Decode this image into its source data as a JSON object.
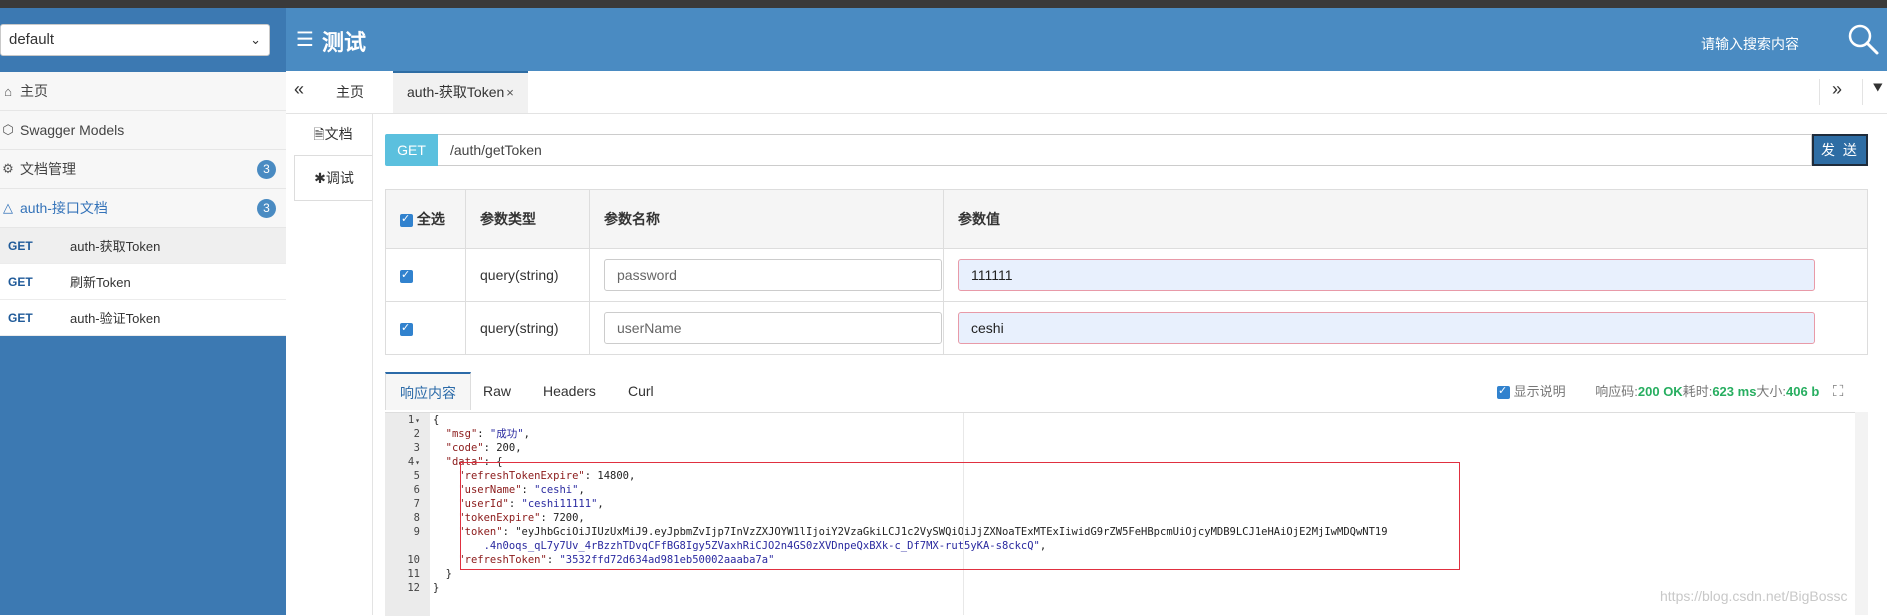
{
  "sidebar": {
    "group_select": "default",
    "menu": [
      {
        "label": "主页",
        "icon": "home-icon"
      },
      {
        "label": "Swagger Models",
        "icon": "cube-icon"
      },
      {
        "label": "文档管理",
        "icon": "gear-icon",
        "badge": "3"
      },
      {
        "label": "auth-接口文档",
        "icon": "folder-icon",
        "badge": "3"
      }
    ],
    "apis": [
      {
        "method": "GET",
        "name": "auth-获取Token"
      },
      {
        "method": "GET",
        "name": "刷新Token"
      },
      {
        "method": "GET",
        "name": "auth-验证Token"
      }
    ]
  },
  "header": {
    "title": "测试",
    "search_placeholder": "请输入搜索内容"
  },
  "tabs": {
    "home": "主页",
    "active": "auth-获取Token",
    "close": "×"
  },
  "subtabs": {
    "doc": "文档",
    "debug": "调试"
  },
  "request": {
    "method": "GET",
    "url": "/auth/getToken",
    "send": "发 送"
  },
  "params": {
    "headers": {
      "select_all": "全选",
      "type": "参数类型",
      "name": "参数名称",
      "value": "参数值"
    },
    "rows": [
      {
        "type": "query(string)",
        "name": "password",
        "value": "111111"
      },
      {
        "type": "query(string)",
        "name": "userName",
        "value": "ceshi"
      }
    ]
  },
  "response": {
    "tabs": [
      "响应内容",
      "Raw",
      "Headers",
      "Curl"
    ],
    "show_desc": "显示说明",
    "code_label": "响应码:",
    "code_value": "200 OK",
    "time_label": "耗时:",
    "time_value": "623 ms",
    "size_label": "大小:",
    "size_value": "406 b",
    "lines": [
      "{",
      "  \"msg\": \"成功\",",
      "  \"code\": 200,",
      "  \"data\": {",
      "    \"refreshTokenExpire\": 14800,",
      "    \"userName\": \"ceshi\",",
      "    \"userId\": \"ceshi11111\",",
      "    \"tokenExpire\": 7200,",
      "    \"token\": \"eyJhbGciOiJIUzUxMiJ9.eyJpbmZvIjp7InVzZXJOYW1lIjoiY2VzaGkiLCJ1c2VySWQiOiJjZXNoaTExMTExIiwidG9rZW5FeHBpcmUiOjcyMDB9LCJ1eHAiOjE2MjIwMDQwNT19",
      "        .4n0oqs_qL7y7Uv_4rBzzhTDvqCFfBG8Igy5ZVaxhRiCJO2n4GS0zXVDnpeQxBXk-c_Df7MX-rut5yKA-s8ckcQ\",",
      "    \"refreshToken\": \"3532ffd72d634ad981eb50002aaaba7a\"",
      "  }",
      "}"
    ],
    "gutter": [
      "1",
      "2",
      "3",
      "4",
      "5",
      "6",
      "7",
      "8",
      "9",
      "",
      "10",
      "11",
      "12"
    ]
  },
  "watermark": "https://blog.csdn.net/BigBossc"
}
